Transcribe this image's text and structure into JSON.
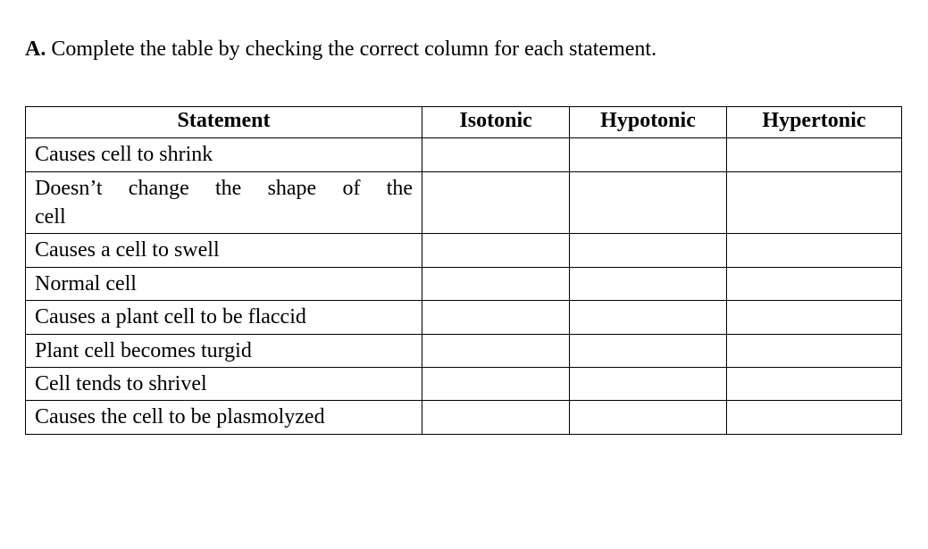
{
  "instruction": {
    "prefix": "A.",
    "text": "Complete the table by checking the correct column for each statement."
  },
  "table": {
    "headers": {
      "statement": "Statement",
      "isotonic": "Isotonic",
      "hypotonic": "Hypotonic",
      "hypertonic": "Hypertonic"
    },
    "rows": [
      {
        "statement": "Causes cell to shrink",
        "statement_line2": "",
        "isotonic": "",
        "hypotonic": "",
        "hypertonic": ""
      },
      {
        "statement": "Doesn’t change the shape of the",
        "statement_line2": "cell",
        "isotonic": "",
        "hypotonic": "",
        "hypertonic": ""
      },
      {
        "statement": "Causes a cell to swell",
        "statement_line2": "",
        "isotonic": "",
        "hypotonic": "",
        "hypertonic": ""
      },
      {
        "statement": "Normal cell",
        "statement_line2": "",
        "isotonic": "",
        "hypotonic": "",
        "hypertonic": ""
      },
      {
        "statement": "Causes a plant cell to be flaccid",
        "statement_line2": "",
        "isotonic": "",
        "hypotonic": "",
        "hypertonic": ""
      },
      {
        "statement": "Plant cell becomes turgid",
        "statement_line2": "",
        "isotonic": "",
        "hypotonic": "",
        "hypertonic": ""
      },
      {
        "statement": "Cell tends to shrivel",
        "statement_line2": "",
        "isotonic": "",
        "hypotonic": "",
        "hypertonic": ""
      },
      {
        "statement": "Causes the cell to be plasmolyzed",
        "statement_line2": "",
        "isotonic": "",
        "hypotonic": "",
        "hypertonic": ""
      }
    ]
  }
}
